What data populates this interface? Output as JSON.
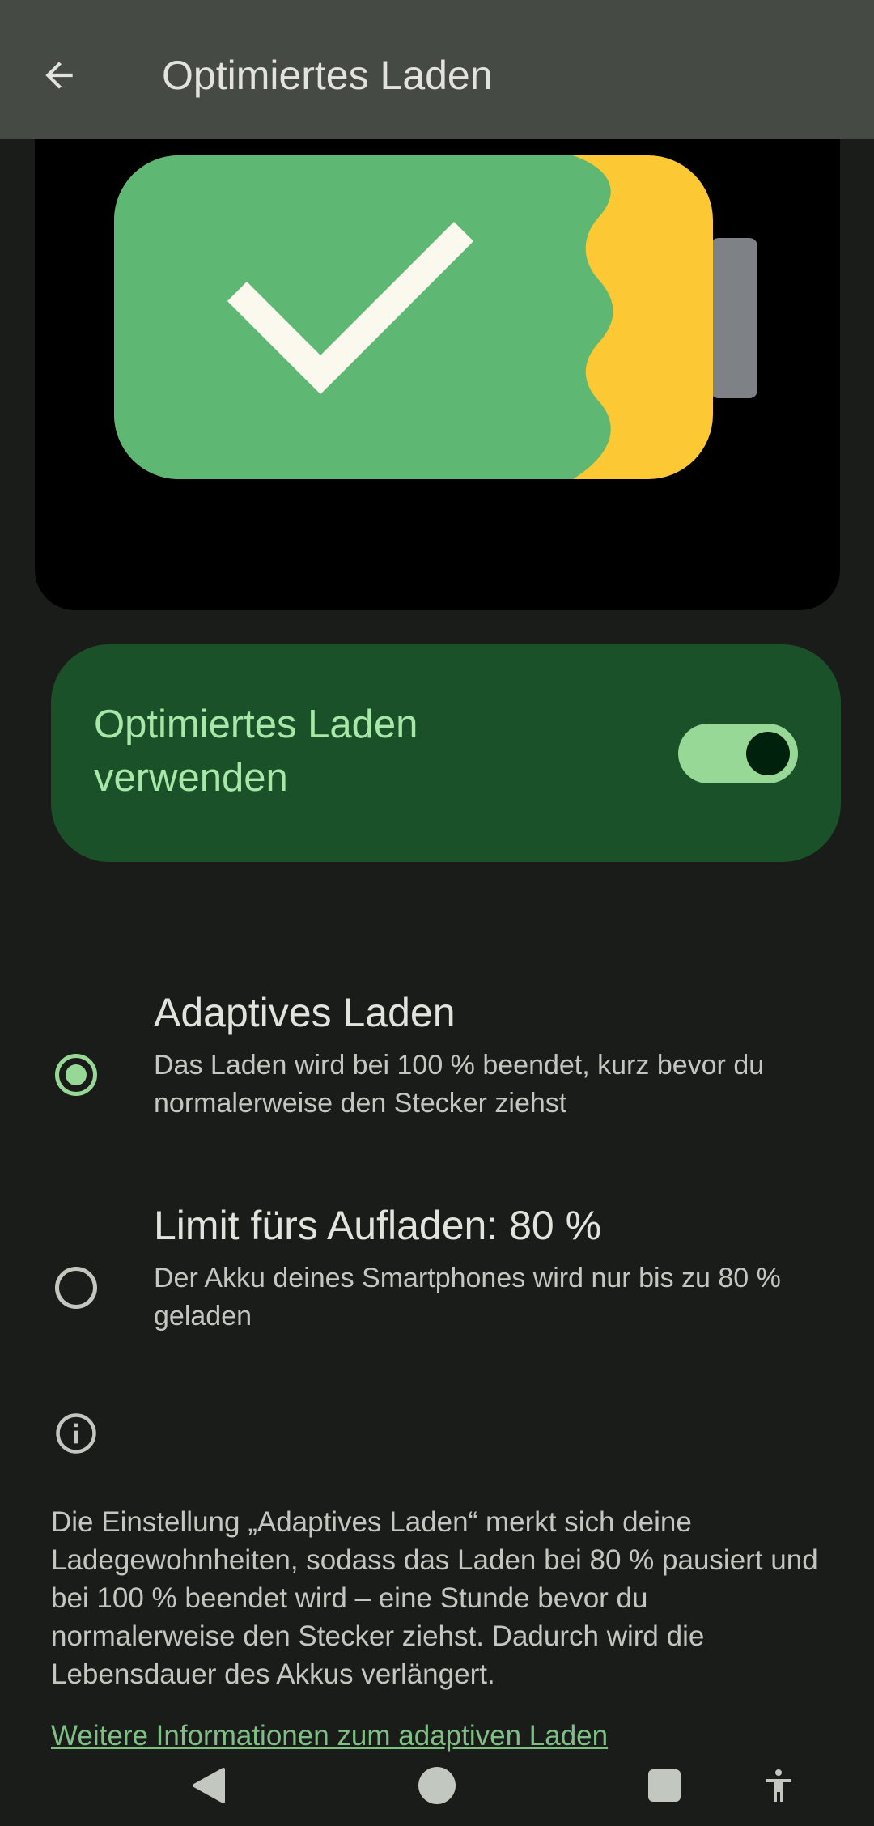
{
  "header": {
    "title": "Optimiertes Laden",
    "back_icon": "arrow-left-icon"
  },
  "illustration": {
    "icon": "battery-check-icon",
    "colors": {
      "charged": "#5eb874",
      "remaining": "#fcc934",
      "terminal": "#7e8185",
      "check": "#fbf8ee"
    }
  },
  "toggle": {
    "label": "Optimiertes Laden verwenden",
    "checked": true
  },
  "options": [
    {
      "title": "Adaptives Laden",
      "description": "Das Laden wird bei 100 % beendet, kurz bevor du normalerweise den Stecker ziehst",
      "selected": true
    },
    {
      "title": "Limit fürs Aufladen: 80 %",
      "description": "Der Akku deines Smartphones wird nur bis zu 80 % geladen",
      "selected": false
    }
  ],
  "info": {
    "icon": "info-icon",
    "text": "Die Einstellung „Adaptives Laden“ merkt sich deine Ladegewohnheiten, sodass das Laden bei 80 % pausiert und bei 100 % beendet wird – eine Stunde bevor du normalerweise den Stecker ziehst. Dadurch wird die Lebensdauer des Akkus verlängert.",
    "link": "Weitere Informationen zum adaptiven Laden"
  },
  "navbar": {
    "icons": [
      "back-triangle-icon",
      "home-circle-icon",
      "recents-square-icon",
      "accessibility-icon"
    ]
  },
  "colors": {
    "accent": "#98d897",
    "card": "#1b5129",
    "background": "#1a1c19",
    "appbar": "#454a44"
  }
}
